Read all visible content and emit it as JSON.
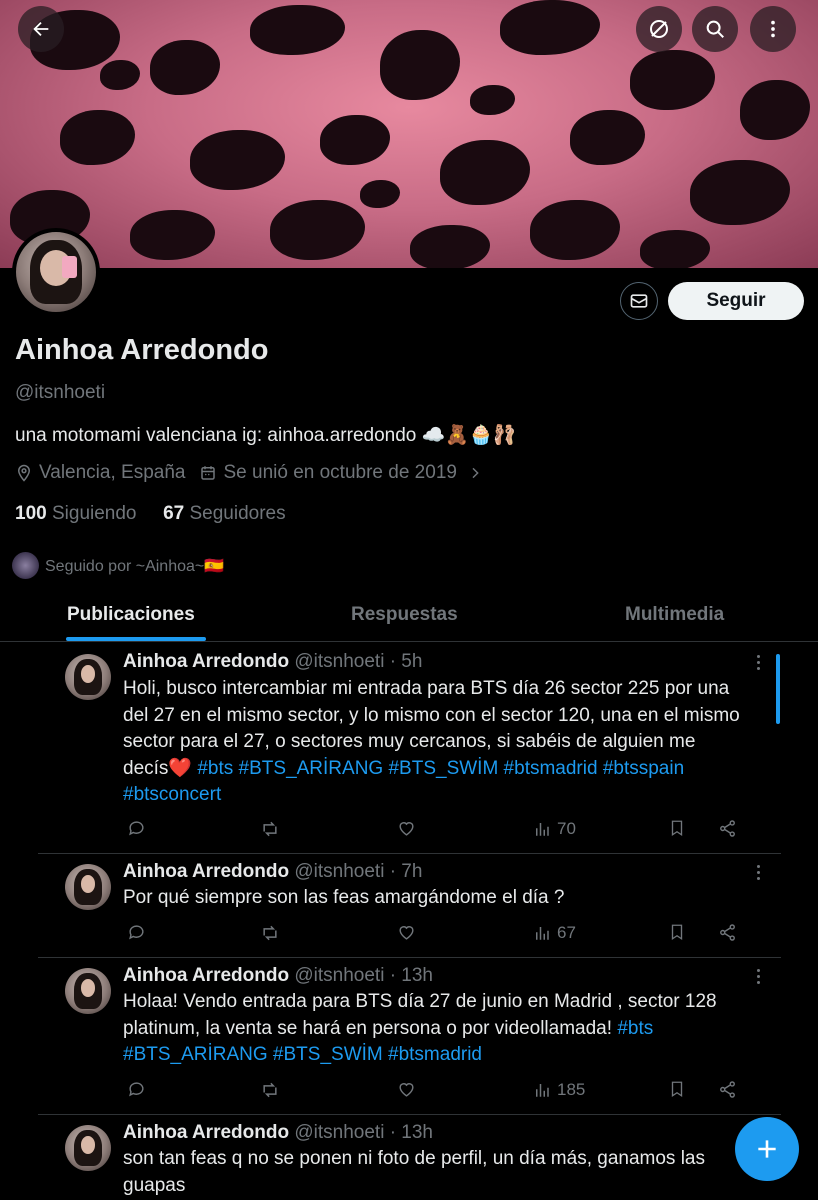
{
  "header": {
    "back_icon": "arrow-left-icon",
    "icons": [
      "grok-icon",
      "search-icon",
      "more-vertical-icon"
    ]
  },
  "profile": {
    "name": "Ainhoa Arredondo",
    "handle": "@itsnhoeti",
    "bio": "una motomami valenciana  ig: ainhoa.arredondo ☁️🧸🧁🩰",
    "location": "Valencia, España",
    "joined": "Se unió en octubre de 2019",
    "following_count": "100",
    "following_label": "Siguiendo",
    "followers_count": "67",
    "followers_label": "Seguidores",
    "followed_by": "Seguido por ~Ainhoa~🇪🇸",
    "follow_button": "Seguir"
  },
  "tabs": [
    {
      "label": "Publicaciones",
      "active": true
    },
    {
      "label": "Respuestas",
      "active": false
    },
    {
      "label": "Multimedia",
      "active": false
    }
  ],
  "tweets": [
    {
      "name": "Ainhoa Arredondo",
      "handle_time": "@itsnhoeti · 5h",
      "text": "Holi, busco intercambiar mi entrada para BTS día 26 sector 225 por una del 27 en el mismo sector, y lo mismo con el sector 120, una en el mismo sector para el 27, o sectores muy cercanos, si sabéis de alguien me decís❤️",
      "tags": "#bts #BTS_ARİRANG #BTS_SWİM #btsmadrid #btsspain #btsconcert",
      "views": "70"
    },
    {
      "name": "Ainhoa Arredondo",
      "handle_time": "@itsnhoeti · 7h",
      "text": "Por qué siempre son las feas amargándome el día ?",
      "tags": "",
      "views": "67"
    },
    {
      "name": "Ainhoa Arredondo",
      "handle_time": "@itsnhoeti · 13h",
      "text": "Holaa! Vendo entrada para BTS día 27 de junio en Madrid , sector 128 platinum, la venta se hará en persona o por videollamada!",
      "tags": "#bts #BTS_ARİRANG #BTS_SWİM #btsmadrid",
      "views": "185"
    },
    {
      "name": "Ainhoa Arredondo",
      "handle_time": "@itsnhoeti · 13h",
      "text": "son tan feas q no se ponen ni foto de perfil, un día más, ganamos las guapas",
      "tags": "",
      "views": ""
    }
  ],
  "colors": {
    "accent": "#1d9bf0",
    "secondary_text": "#71767b",
    "divider": "#2f3336"
  }
}
